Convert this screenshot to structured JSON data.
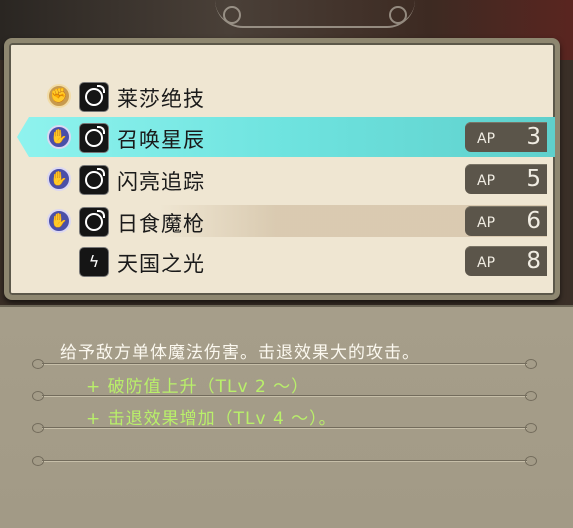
{
  "skills": [
    {
      "name": "莱莎绝技",
      "type_icon": "fist-icon",
      "skill_icon": "bomb-icon",
      "ap": null,
      "ap_label": ""
    },
    {
      "name": "召唤星辰",
      "type_icon": "magic-hand-icon",
      "skill_icon": "bomb-icon",
      "ap": "3",
      "ap_label": "AP",
      "selected": true
    },
    {
      "name": "闪亮追踪",
      "type_icon": "magic-hand-icon",
      "skill_icon": "bomb-icon",
      "ap": "5",
      "ap_label": "AP"
    },
    {
      "name": "日食魔枪",
      "type_icon": "magic-hand-icon",
      "skill_icon": "bomb-icon",
      "ap": "6",
      "ap_label": "AP"
    },
    {
      "name": "天国之光",
      "type_icon": "",
      "skill_icon": "lightning-emblem-icon",
      "ap": "8",
      "ap_label": "AP"
    }
  ],
  "description": {
    "main": "给予敌方单体魔法伤害。击退效果大的攻击。",
    "bonuses": [
      "+ 破防值上升（TLv 2 ～）",
      "+ 击退效果增加（TLv 4 ～）。"
    ]
  },
  "colors": {
    "selected_highlight": "#6ee3df",
    "bonus_text": "#b9f06a",
    "panel": "#efe6d2"
  }
}
